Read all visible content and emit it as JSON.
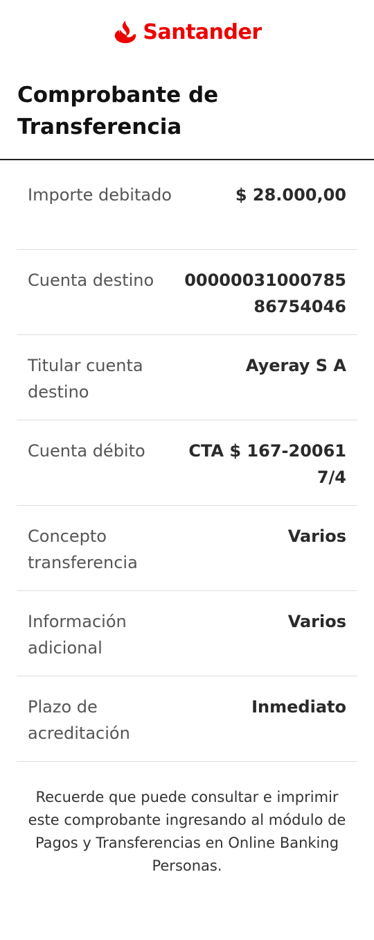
{
  "brand": {
    "name": "Santander",
    "color": "#ec0000",
    "icon": "santander-flame-icon"
  },
  "page": {
    "title": "Comprobante de Transferencia"
  },
  "details": [
    {
      "label": "Importe debitado",
      "value": "$ 28.000,00"
    },
    {
      "label": "Cuenta destino",
      "value": "0000003100078586754046"
    },
    {
      "label": "Titular cuenta destino",
      "value": "Ayeray S A"
    },
    {
      "label": "Cuenta débito",
      "value": "CTA $ 167-200617/4"
    },
    {
      "label": "Concepto transferencia",
      "value": "Varios"
    },
    {
      "label": "Información adicional",
      "value": "Varios"
    },
    {
      "label": "Plazo de acreditación",
      "value": "Inmediato"
    }
  ],
  "footer": {
    "note": "Recuerde que puede consultar e imprimir este comprobante ingresando al módulo de Pagos y Transferencias en Online Banking Personas."
  }
}
